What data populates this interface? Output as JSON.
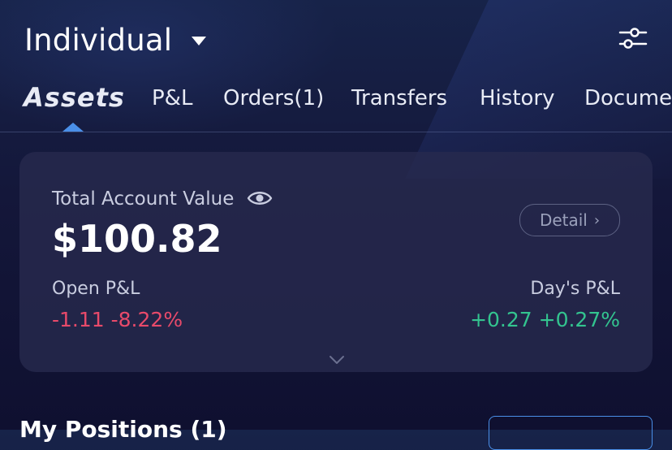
{
  "header": {
    "account_name": "Individual",
    "icons": {
      "caret": "caret-down-icon",
      "filter": "sliders-icon"
    }
  },
  "tabs": [
    {
      "label": "Assets",
      "active": true
    },
    {
      "label": "P&L",
      "active": false
    },
    {
      "label": "Orders(1)",
      "active": false
    },
    {
      "label": "Transfers",
      "active": false
    },
    {
      "label": "History",
      "active": false
    },
    {
      "label": "Documents",
      "active": false
    }
  ],
  "summary": {
    "total_label": "Total Account Value",
    "total_value": "$100.82",
    "detail_label": "Detail",
    "open_pl_label": "Open P&L",
    "open_pl_value": "-1.11 -8.22%",
    "day_pl_label": "Day's P&L",
    "day_pl_value": "+0.27 +0.27%",
    "icons": {
      "visibility": "eye-icon",
      "detail": "chevron-right-icon",
      "expand": "chevron-down-icon"
    }
  },
  "positions": {
    "title": "My Positions (1)"
  },
  "colors": {
    "accent": "#4a8fe8",
    "negative": "#e84a6a",
    "positive": "#33c48f",
    "card": "#28294e"
  }
}
